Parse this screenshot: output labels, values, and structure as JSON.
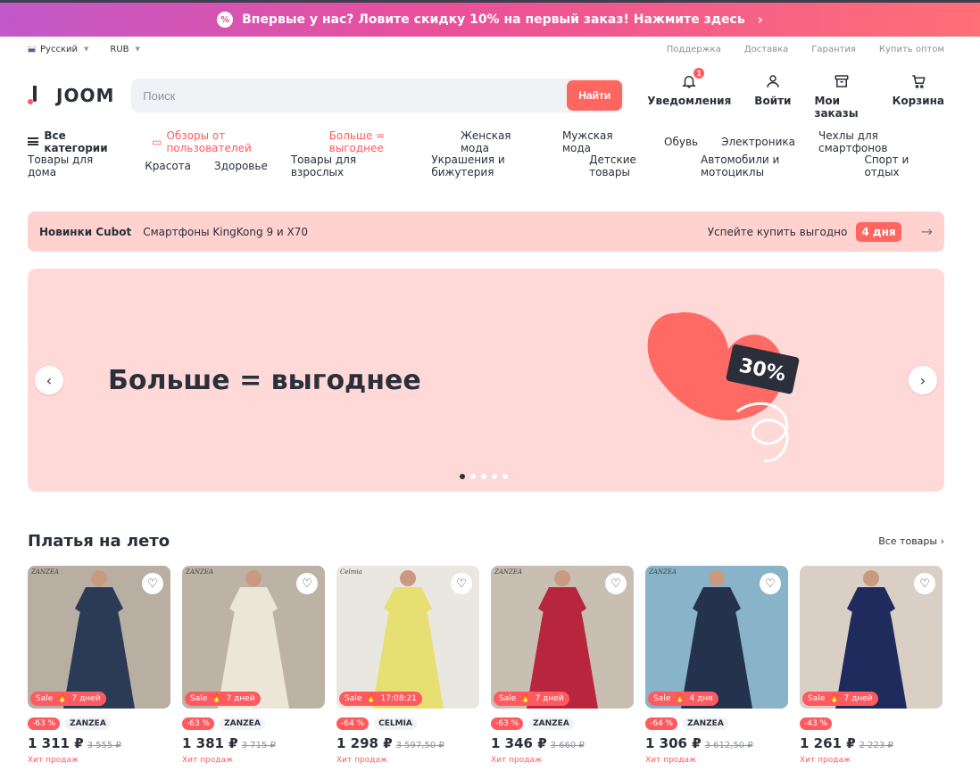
{
  "promo": {
    "icon": "percent-icon",
    "text": "Впервые у нас? Ловите скидку 10% на первый заказ! Нажмите здесь"
  },
  "util": {
    "language": "Русский",
    "currency": "RUB",
    "links": [
      "Поддержка",
      "Доставка",
      "Гарантия",
      "Купить оптом"
    ]
  },
  "header": {
    "logo_text": "JOOM",
    "search": {
      "placeholder": "Поиск",
      "button": "Найти"
    },
    "actions": [
      {
        "label": "Уведомления",
        "icon": "bell-icon",
        "badge": "1"
      },
      {
        "label": "Войти",
        "icon": "user-icon"
      },
      {
        "label": "Мои заказы",
        "icon": "box-icon"
      },
      {
        "label": "Корзина",
        "icon": "cart-icon"
      }
    ]
  },
  "categories": {
    "row1": [
      "Все категории",
      "Обзоры от пользователей",
      "Больше = выгоднее",
      "Женская мода",
      "Мужская мода",
      "Обувь",
      "Электроника",
      "Чехлы для смартфонов"
    ],
    "row2": [
      "Товары для дома",
      "Красота",
      "Здоровье",
      "Товары для взрослых",
      "Украшения и бижутерия",
      "Детские товары",
      "Автомобили и мотоциклы",
      "Спорт и отдых"
    ]
  },
  "notice": {
    "brand": "Новинки Cubot",
    "text": "Смартфоны KingKong 9 и X70",
    "cta": "Успейте купить выгодно",
    "days": "4 дня"
  },
  "hero": {
    "title": "Больше = выгоднее",
    "badge": "30%",
    "slides": 5,
    "active_slide": 1
  },
  "section": {
    "title": "Платья на лето",
    "all_link": "Все товары"
  },
  "products": [
    {
      "sale": "Sale",
      "timer": "7 дней",
      "discount": "-63 %",
      "brand": "ZANZEA",
      "price": "1 311 ₽",
      "old": "3 555 ₽",
      "tag": "Хит продаж",
      "stamp": "ZANZEA",
      "bg": "#b8aea2",
      "dress": "#2b3b55"
    },
    {
      "sale": "Sale",
      "timer": "7 дней",
      "discount": "-63 %",
      "brand": "ZANZEA",
      "price": "1 381 ₽",
      "old": "3 715 ₽",
      "tag": "Хит продаж",
      "stamp": "ZANZEA",
      "bg": "#bdb2a6",
      "dress": "#ece6d8"
    },
    {
      "sale": "Sale",
      "timer": "17:08:21",
      "discount": "-64 %",
      "brand": "CELMIA",
      "price": "1 298 ₽",
      "old": "3 597,50 ₽",
      "tag": "Хит продаж",
      "stamp": "Celmia",
      "bg": "#e9e7e0",
      "dress": "#e8df72"
    },
    {
      "sale": "Sale",
      "timer": "7 дней",
      "discount": "-63 %",
      "brand": "ZANZEA",
      "price": "1 346 ₽",
      "old": "3 660 ₽",
      "tag": "Хит продаж",
      "stamp": "ZANZEA",
      "bg": "#c8beb2",
      "dress": "#b8263d"
    },
    {
      "sale": "Sale",
      "timer": "4 дня",
      "discount": "-64 %",
      "brand": "ZANZEA",
      "price": "1 306 ₽",
      "old": "3 612,50 ₽",
      "tag": "Хит продаж",
      "stamp": "ZANZEA",
      "bg": "#88b3c9",
      "dress": "#24324e"
    },
    {
      "sale": "Sale",
      "timer": "7 дней",
      "discount": "-43 %",
      "brand": "",
      "price": "1 261 ₽",
      "old": "2 223 ₽",
      "tag": "Хит продаж",
      "stamp": "",
      "bg": "#d9cfc4",
      "dress": "#1f2b5c"
    }
  ],
  "colors": {
    "accent": "#ff5a5f",
    "notice_bg": "#ffd2d0",
    "hero_bg": "#ffd8d8",
    "text": "#2a2f3a"
  }
}
